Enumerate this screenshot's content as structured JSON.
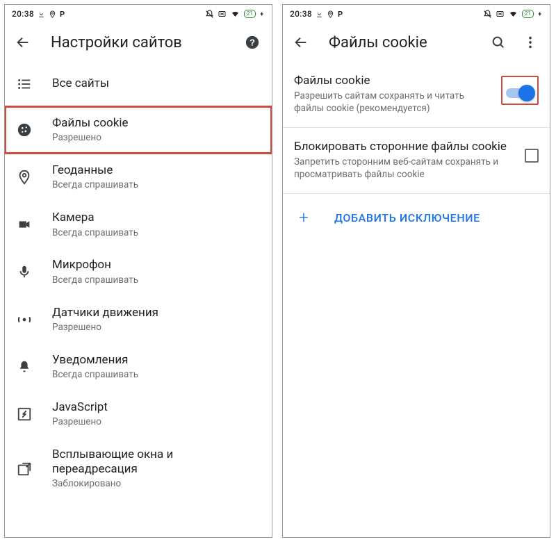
{
  "status": {
    "time": "20:38",
    "battery": "21"
  },
  "left": {
    "title": "Настройки сайтов",
    "items": [
      {
        "icon": "list",
        "primary": "Все сайты",
        "secondary": ""
      },
      {
        "icon": "cookie",
        "primary": "Файлы cookie",
        "secondary": "Разрешено",
        "highlight": true
      },
      {
        "icon": "location",
        "primary": "Геоданные",
        "secondary": "Всегда спрашивать"
      },
      {
        "icon": "camera",
        "primary": "Камера",
        "secondary": "Всегда спрашивать"
      },
      {
        "icon": "mic",
        "primary": "Микрофон",
        "secondary": "Всегда спрашивать"
      },
      {
        "icon": "motion",
        "primary": "Датчики движения",
        "secondary": "Разрешено"
      },
      {
        "icon": "bell",
        "primary": "Уведомления",
        "secondary": "Всегда спрашивать"
      },
      {
        "icon": "js",
        "primary": "JavaScript",
        "secondary": "Разрешено"
      },
      {
        "icon": "popup",
        "primary": "Всплывающие окна и переадресация",
        "secondary": "Заблокировано"
      }
    ]
  },
  "right": {
    "title": "Файлы cookie",
    "cookies": {
      "title": "Файлы cookie",
      "desc": "Разрешить сайтам сохранять и читать файлы cookie (рекомендуется)",
      "enabled": true
    },
    "block3p": {
      "title": "Блокировать сторонние файлы cookie",
      "desc": "Запретить сторонним веб-сайтам сохранять и просматривать файлы cookie",
      "checked": false
    },
    "add_exception": "ДОБАВИТЬ ИСКЛЮЧЕНИЕ"
  }
}
